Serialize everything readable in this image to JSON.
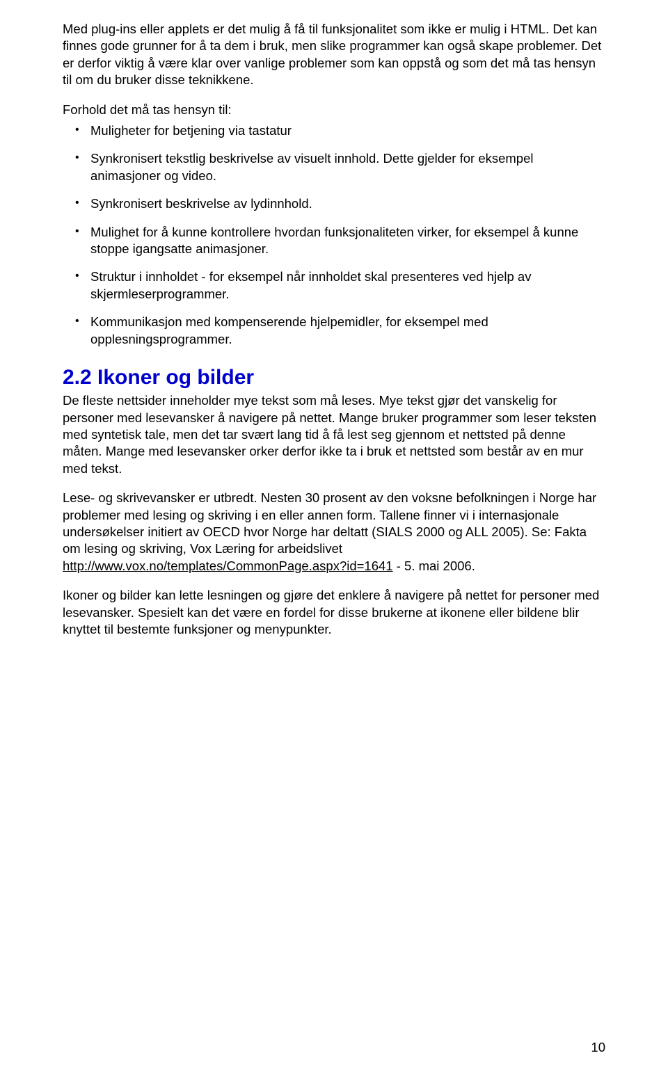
{
  "intro": {
    "p1": "Med plug-ins eller applets er det mulig å få til funksjonalitet som ikke er mulig i HTML. Det kan finnes gode grunner for å ta dem i bruk, men slike programmer kan også skape problemer. Det er derfor viktig å være klar over vanlige problemer som kan oppstå og som det må tas hensyn til om du bruker disse teknikkene.",
    "p2": "Forhold det må tas hensyn til:"
  },
  "bullets": [
    "Muligheter for betjening via tastatur",
    "Synkronisert tekstlig beskrivelse av visuelt innhold. Dette gjelder for eksempel animasjoner og video.",
    "Synkronisert beskrivelse av lydinnhold.",
    "Mulighet for å kunne kontrollere hvordan funksjonaliteten virker, for eksempel å kunne stoppe igangsatte animasjoner.",
    "Struktur i innholdet - for eksempel når innholdet skal presenteres ved hjelp av skjermleserprogrammer.",
    "Kommunikasjon med kompenserende hjelpemidler, for eksempel med opplesningsprogrammer."
  ],
  "section": {
    "heading": "2.2 Ikoner og bilder",
    "p1": "De fleste nettsider inneholder mye tekst som må leses. Mye tekst gjør det vanskelig for personer med lesevansker å navigere på nettet. Mange bruker programmer som leser teksten med syntetisk tale, men det tar svært lang tid å få lest seg gjennom et nettsted på denne måten. Mange med lesevansker orker derfor ikke ta i bruk et nettsted som består av en mur med tekst.",
    "p2_pre": "Lese- og skrivevansker er utbredt. Nesten 30 prosent av den voksne befolkningen i Norge har problemer med lesing og skriving i en eller annen form. Tallene finner vi i internasjonale undersøkelser initiert av OECD hvor Norge har deltatt (SIALS 2000 og ALL 2005). Se: Fakta om lesing og skriving,  Vox Læring for arbeidslivet ",
    "p2_link": "http://www.vox.no/templates/CommonPage.aspx?id=1641",
    "p2_post": " - 5. mai 2006.",
    "p3": "Ikoner og bilder kan lette lesningen og gjøre det enklere å navigere på nettet for personer med lesevansker. Spesielt kan det være en fordel for disse brukerne at ikonene eller bildene blir knyttet til bestemte funksjoner og menypunkter."
  },
  "page_number": "10"
}
